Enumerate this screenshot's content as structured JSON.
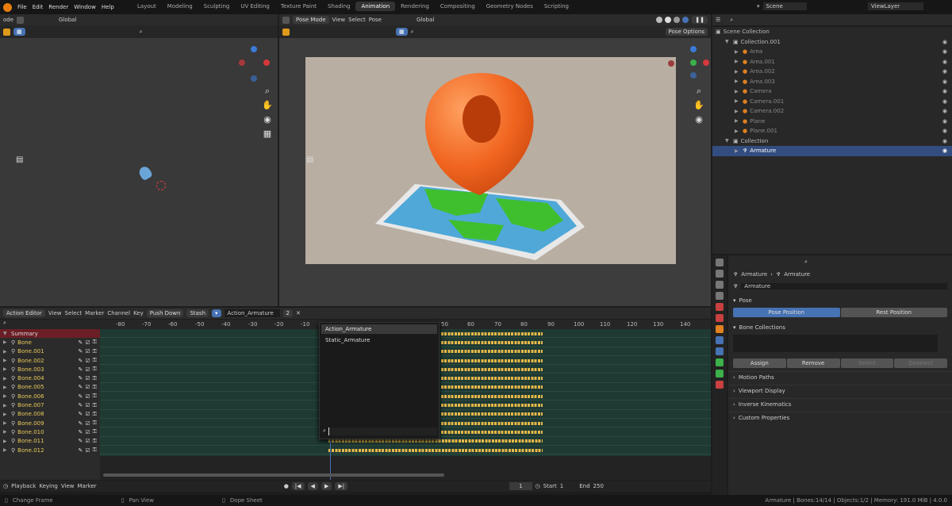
{
  "menu": {
    "file": "File",
    "edit": "Edit",
    "render": "Render",
    "window": "Window",
    "help": "Help"
  },
  "workspaces": [
    "Layout",
    "Modeling",
    "Sculpting",
    "UV Editing",
    "Texture Paint",
    "Shading",
    "Animation",
    "Rendering",
    "Compositing",
    "Geometry Nodes",
    "Scripting"
  ],
  "active_workspace": "Animation",
  "scene": {
    "name": "Scene",
    "view_layer": "ViewLayer"
  },
  "left_viewport": {
    "mode": "ode",
    "transform": "Global"
  },
  "camera_viewport": {
    "mode": "Pose Mode",
    "view": "View",
    "select": "Select",
    "pose": "Pose",
    "transform": "Global",
    "pose_options": "Pose Options"
  },
  "outliner": {
    "title": "Scene Collection",
    "collection1": "Collection.001",
    "items": [
      "Area",
      "Area.001",
      "Area.002",
      "Area.003",
      "Camera",
      "Camera.001",
      "Camera.002",
      "Plane",
      "Plane.001"
    ],
    "collection2": "Collection",
    "armature": "Armature"
  },
  "properties": {
    "breadcrumb1": "Armature",
    "breadcrumb2": "Armature",
    "name": "Armature",
    "pose_section": "Pose",
    "pose_position": "Pose Position",
    "rest_position": "Rest Position",
    "bone_collections": "Bone Collections",
    "assign": "Assign",
    "remove": "Remove",
    "select": "Select",
    "deselect": "Deselect",
    "panels": [
      "Motion Paths",
      "Viewport Display",
      "Inverse Kinematics",
      "Custom Properties"
    ]
  },
  "action_editor": {
    "mode": "Action Editor",
    "view": "View",
    "select": "Select",
    "marker": "Marker",
    "channel": "Channel",
    "key": "Key",
    "push_down": "Push Down",
    "stash": "Stash",
    "action": "Action_Armature",
    "users": "2",
    "ruler": [
      "-80",
      "-70",
      "-60",
      "-50",
      "-40",
      "-30",
      "-20",
      "-10",
      "50",
      "60",
      "70",
      "80",
      "90",
      "100",
      "110",
      "120",
      "130",
      "140"
    ],
    "summary": "Summary",
    "bones": [
      "Bone",
      "Bone.001",
      "Bone.002",
      "Bone.003",
      "Bone.004",
      "Bone.005",
      "Bone.006",
      "Bone.007",
      "Bone.008",
      "Bone.009",
      "Bone.010",
      "Bone.011",
      "Bone.012"
    ],
    "dropdown": [
      "Action_Armature",
      "Static_Armature"
    ]
  },
  "timeline": {
    "playback": "Playback",
    "keying": "Keying",
    "view": "View",
    "marker": "Marker",
    "frame": "1",
    "start_label": "Start",
    "start": "1",
    "end_label": "End",
    "end": "250"
  },
  "status": {
    "left": "Change Frame",
    "mid": "Pan View",
    "right": "Dope Sheet",
    "info": "Armature | Bones:14/14 | Objects:1/2 | Memory: 191.0 MiB | 4.0.0"
  },
  "colors": {
    "accent": "#4772b3",
    "summary": "#6b1e25",
    "dope_bg": "#1f3a33",
    "keyframe": "#e6b84a",
    "pin": "#e8742a",
    "map_green": "#3fbf2e",
    "map_water": "#4fa8d8"
  }
}
